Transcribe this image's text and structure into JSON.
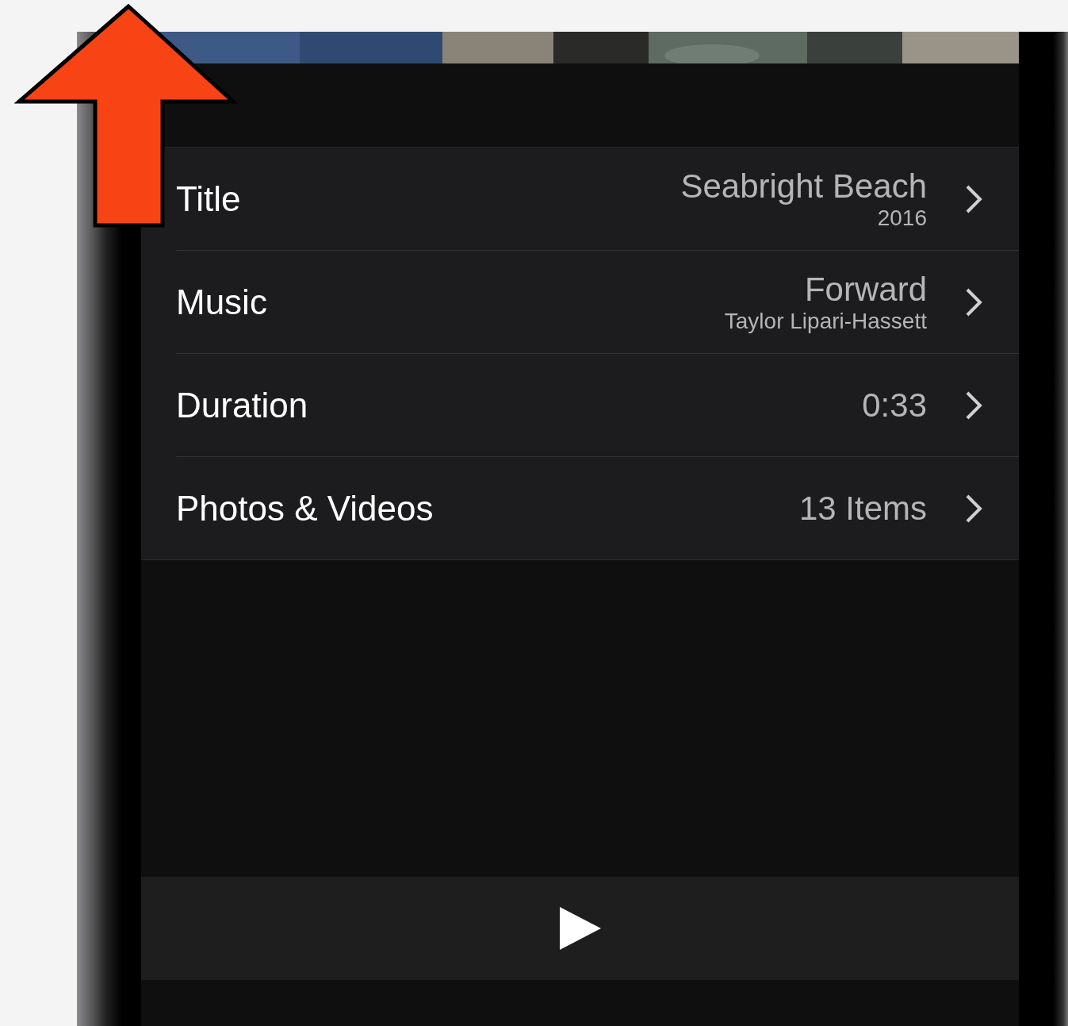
{
  "rows": [
    {
      "label": "Title",
      "value": "Seabright Beach",
      "detail": "2016"
    },
    {
      "label": "Music",
      "value": "Forward",
      "detail": "Taylor Lipari-Hassett"
    },
    {
      "label": "Duration",
      "value": "0:33"
    },
    {
      "label": "Photos & Videos",
      "value": "13 Items"
    }
  ]
}
